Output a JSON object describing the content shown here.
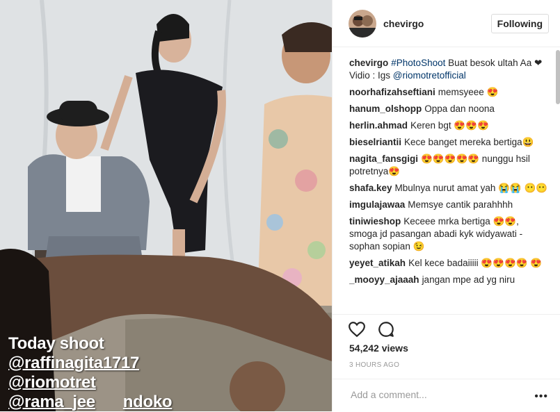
{
  "post": {
    "username": "chevirgo",
    "follow_label": "Following",
    "overlay_lines": [
      "Today shoot",
      "@raffinagita1717",
      "@riomotret",
      "@rama_jee",
      "ndoko"
    ]
  },
  "caption": {
    "user": "chevirgo",
    "hashtag": "#PhotoShoot",
    "text": " Buat besok ultah Aa ❤ Vidio : Igs ",
    "mention": "@riomotretofficial"
  },
  "comments": [
    {
      "user": "noorhafizahseftiani",
      "text": "memsyeee 😍"
    },
    {
      "user": "hanum_olshopp",
      "text": "Oppa dan noona"
    },
    {
      "user": "herlin.ahmad",
      "text": "Keren bgt 😍😍😍"
    },
    {
      "user": "bieselriantii",
      "text": "Kece banget mereka bertiga😃"
    },
    {
      "user": "nagita_fansgigi",
      "text": "😍😍😍😍😍 nunggu hsil potretnya😍"
    },
    {
      "user": "shafa.key",
      "text": "Mbulnya nurut amat yah 😭😭 😶😶"
    },
    {
      "user": "imgulajawaa",
      "text": "Memsye cantik parahhhh"
    },
    {
      "user": "tiniwieshop",
      "text": "Keceee mrka bertiga 😍😍, smoga jd pasangan abadi kyk widyawati - sophan sopian 😉"
    },
    {
      "user": "yeyet_atikah",
      "text": "Kel kece badaiiiii 😍😍😍😍 😍"
    },
    {
      "user": "_mooyy_ajaaah",
      "text": "jangan mpe ad yg niru"
    }
  ],
  "stats": {
    "views_count": "54,242",
    "views_label": " views",
    "time_ago": "3 HOURS AGO"
  },
  "add_comment": {
    "placeholder": "Add a comment..."
  },
  "icons": {
    "like": "heart-icon",
    "comment": "speech-bubble-icon",
    "more": "more-dots-icon"
  }
}
